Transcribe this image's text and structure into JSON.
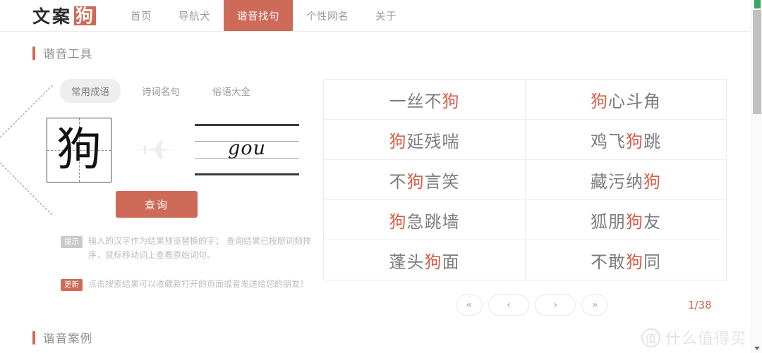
{
  "nav": {
    "logo_plain": "文案",
    "logo_mark": "狗",
    "items": [
      {
        "label": "首页",
        "active": false
      },
      {
        "label": "导航犬",
        "active": false
      },
      {
        "label": "谐音找句",
        "active": true
      },
      {
        "label": "个性网名",
        "active": false
      },
      {
        "label": "关于",
        "active": false
      }
    ]
  },
  "sections": {
    "tool_title": "谐音工具",
    "case_title": "谐音案例"
  },
  "tool": {
    "tabs": [
      {
        "label": "常用成语",
        "active": true
      },
      {
        "label": "诗词名句",
        "active": false
      },
      {
        "label": "俗语大全",
        "active": false
      }
    ],
    "input_char": "狗",
    "pinyin": "gou",
    "query_label": "查询",
    "notes": [
      {
        "badge": "提示",
        "text": "输入的汉字作为结果预览替换的字； 查询结果已按照词频排序，鼠标移动词上查看原始词句。"
      },
      {
        "badge": "更新",
        "text": "点击搜索结果可以收藏新打开的页面或者发送给您的朋友！"
      }
    ]
  },
  "results": {
    "rows": [
      [
        {
          "pre": "一丝不",
          "hl": "狗",
          "post": ""
        },
        {
          "pre": "",
          "hl": "狗",
          "post": "心斗角"
        }
      ],
      [
        {
          "pre": "",
          "hl": "狗",
          "post": "延残喘"
        },
        {
          "pre": "鸡飞",
          "hl": "狗",
          "post": "跳"
        }
      ],
      [
        {
          "pre": "不",
          "hl": "狗",
          "post": "言笑"
        },
        {
          "pre": "藏污纳",
          "hl": "狗",
          "post": ""
        }
      ],
      [
        {
          "pre": "",
          "hl": "狗",
          "post": "急跳墙"
        },
        {
          "pre": "狐朋",
          "hl": "狗",
          "post": "友"
        }
      ],
      [
        {
          "pre": "蓬头",
          "hl": "狗",
          "post": "面"
        },
        {
          "pre": "不敢",
          "hl": "狗",
          "post": "同"
        }
      ]
    ]
  },
  "pager": {
    "first": "«",
    "prev": "‹",
    "next": "›",
    "last": "»",
    "count": "1/38"
  },
  "watermark": {
    "logo": "值",
    "text": "什么值得买"
  },
  "colors": {
    "accent": "#cd6a58",
    "highlight": "#d4604a",
    "text_muted": "#9b9b9b",
    "border": "#eceaea"
  }
}
